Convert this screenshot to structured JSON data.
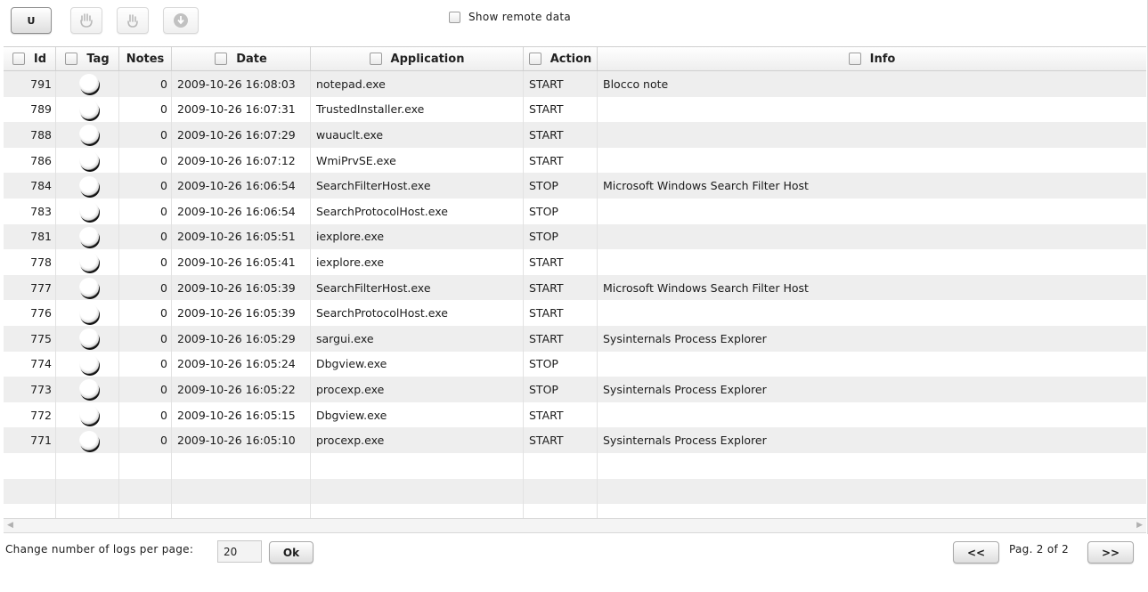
{
  "toolbar": {
    "u_label": "U",
    "remote_label": "Show remote data"
  },
  "columns": [
    {
      "label": "Id",
      "checkbox": true
    },
    {
      "label": "Tag",
      "checkbox": true
    },
    {
      "label": "Notes",
      "checkbox": false
    },
    {
      "label": "Date",
      "checkbox": true
    },
    {
      "label": "Application",
      "checkbox": true
    },
    {
      "label": "Action",
      "checkbox": true
    },
    {
      "label": "Info",
      "checkbox": true
    }
  ],
  "rows": [
    {
      "id": "791",
      "notes": "0",
      "date": "2009-10-26 16:08:03",
      "app": "notepad.exe",
      "action": "START",
      "info": "Blocco note"
    },
    {
      "id": "789",
      "notes": "0",
      "date": "2009-10-26 16:07:31",
      "app": "TrustedInstaller.exe",
      "action": "START",
      "info": ""
    },
    {
      "id": "788",
      "notes": "0",
      "date": "2009-10-26 16:07:29",
      "app": "wuauclt.exe",
      "action": "START",
      "info": ""
    },
    {
      "id": "786",
      "notes": "0",
      "date": "2009-10-26 16:07:12",
      "app": "WmiPrvSE.exe",
      "action": "START",
      "info": ""
    },
    {
      "id": "784",
      "notes": "0",
      "date": "2009-10-26 16:06:54",
      "app": "SearchFilterHost.exe",
      "action": "STOP",
      "info": "Microsoft Windows Search Filter Host"
    },
    {
      "id": "783",
      "notes": "0",
      "date": "2009-10-26 16:06:54",
      "app": "SearchProtocolHost.exe",
      "action": "STOP",
      "info": ""
    },
    {
      "id": "781",
      "notes": "0",
      "date": "2009-10-26 16:05:51",
      "app": "iexplore.exe",
      "action": "STOP",
      "info": ""
    },
    {
      "id": "778",
      "notes": "0",
      "date": "2009-10-26 16:05:41",
      "app": "iexplore.exe",
      "action": "START",
      "info": ""
    },
    {
      "id": "777",
      "notes": "0",
      "date": "2009-10-26 16:05:39",
      "app": "SearchFilterHost.exe",
      "action": "START",
      "info": "Microsoft Windows Search Filter Host"
    },
    {
      "id": "776",
      "notes": "0",
      "date": "2009-10-26 16:05:39",
      "app": "SearchProtocolHost.exe",
      "action": "START",
      "info": ""
    },
    {
      "id": "775",
      "notes": "0",
      "date": "2009-10-26 16:05:29",
      "app": "sargui.exe",
      "action": "START",
      "info": "Sysinternals Process Explorer"
    },
    {
      "id": "774",
      "notes": "0",
      "date": "2009-10-26 16:05:24",
      "app": "Dbgview.exe",
      "action": "STOP",
      "info": ""
    },
    {
      "id": "773",
      "notes": "0",
      "date": "2009-10-26 16:05:22",
      "app": "procexp.exe",
      "action": "STOP",
      "info": "Sysinternals Process Explorer"
    },
    {
      "id": "772",
      "notes": "0",
      "date": "2009-10-26 16:05:15",
      "app": "Dbgview.exe",
      "action": "START",
      "info": ""
    },
    {
      "id": "771",
      "notes": "0",
      "date": "2009-10-26 16:05:10",
      "app": "procexp.exe",
      "action": "START",
      "info": "Sysinternals Process Explorer"
    }
  ],
  "footer": {
    "per_page_label": "Change number of logs per page:",
    "per_page_value": "20",
    "ok_label": "Ok",
    "prev_label": "<<",
    "next_label": ">>",
    "page_info": "Pag. 2 of 2"
  },
  "icons": {
    "toolbar_1": "hand-icon",
    "toolbar_2": "hand-pointer-icon",
    "toolbar_3": "download-icon",
    "tag": "tag-orb-icon"
  }
}
